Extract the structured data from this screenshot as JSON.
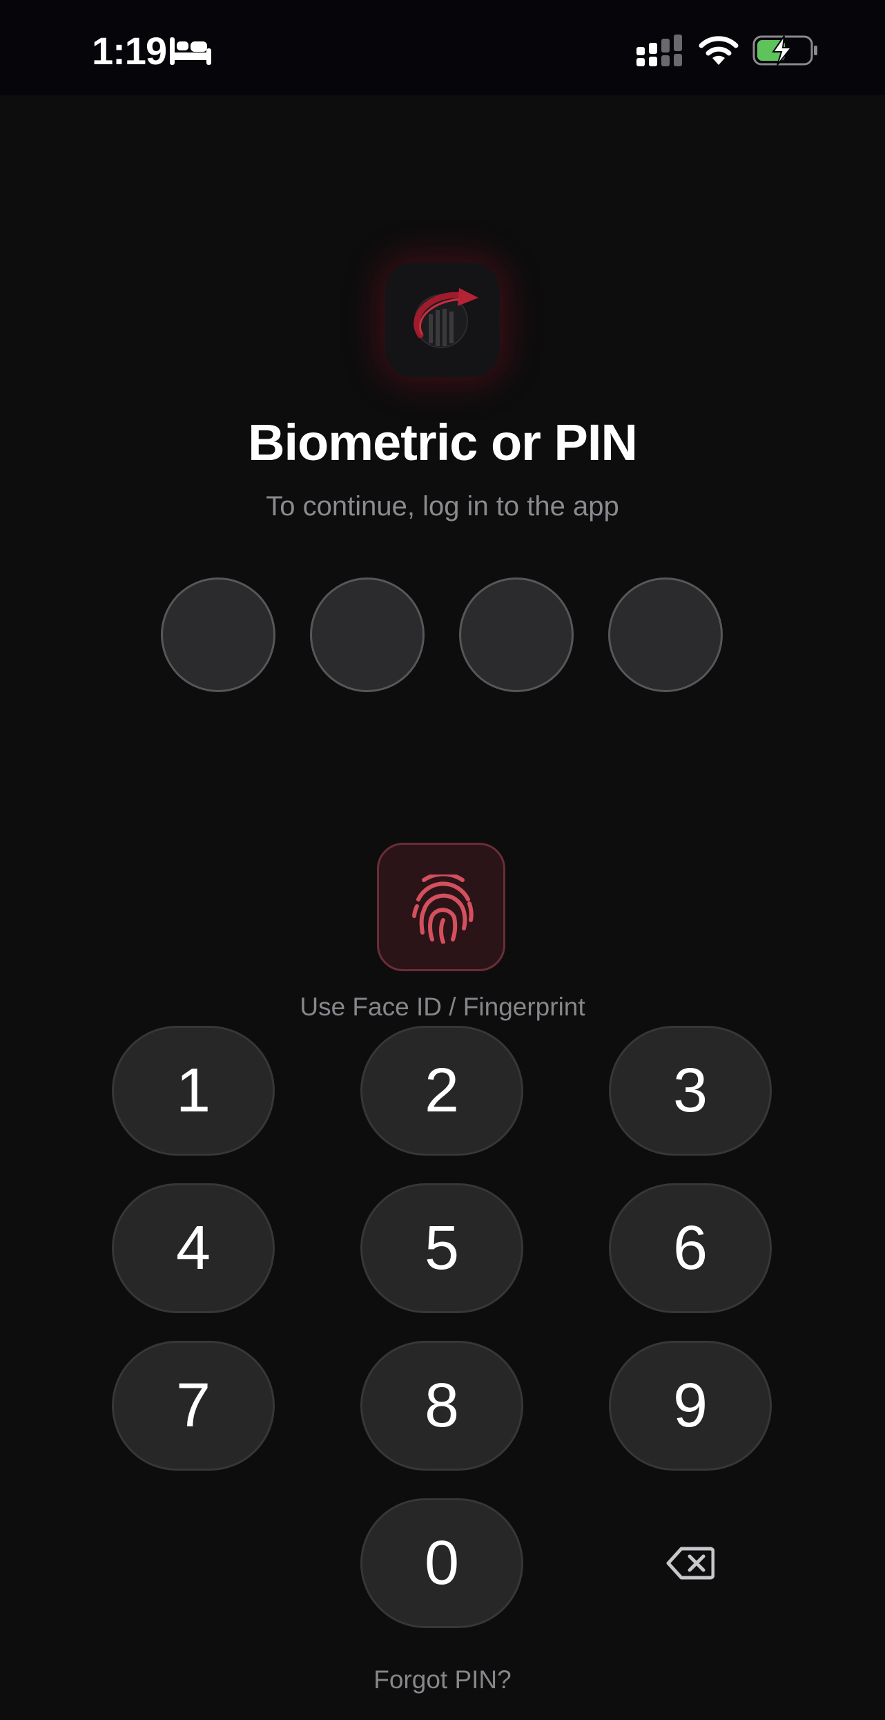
{
  "status_bar": {
    "time": "1:19",
    "icons": [
      "bed-icon",
      "cellular-signal-icon",
      "wifi-icon",
      "battery-charging-icon"
    ]
  },
  "header": {
    "logo_icon": "app-logo-icon",
    "title": "Biometric or PIN",
    "subtitle": "To continue, log in to the app"
  },
  "pin": {
    "length": 4,
    "entered": 0
  },
  "biometric": {
    "icon": "fingerprint-icon",
    "label": "Use Face ID / Fingerprint"
  },
  "keypad": {
    "keys": [
      "1",
      "2",
      "3",
      "4",
      "5",
      "6",
      "7",
      "8",
      "9",
      "0"
    ],
    "backspace_icon": "backspace-icon"
  },
  "footer": {
    "forgot_label": "Forgot PIN?"
  },
  "colors": {
    "background": "#0d0d0e",
    "accent": "#d4505e",
    "key_fill": "#272728",
    "muted_text": "#8a8a8f",
    "battery_green": "#5dc35a"
  }
}
